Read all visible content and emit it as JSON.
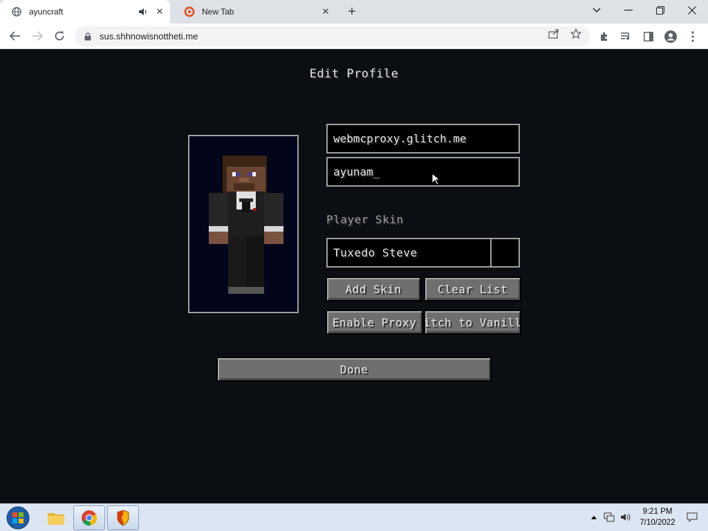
{
  "browser": {
    "tabs": [
      {
        "title": "ayuncraft",
        "icon": "globe-icon",
        "audio": "speaker-icon"
      },
      {
        "title": "New Tab",
        "icon": "duckduckgo-icon"
      }
    ],
    "new_tab_symbol": "+",
    "url": "sus.shhnowisnottheti.me"
  },
  "game": {
    "title": "Edit Profile",
    "server_field": "webmcproxy.glitch.me",
    "username_field": "ayunam_",
    "skin_label": "Player Skin",
    "skin_value": "Tuxedo Steve",
    "buttons": {
      "add_skin": "Add Skin",
      "clear_list": "Clear List",
      "enable_proxy": "Enable Proxy",
      "switch_vanilla": "witch to Vanilla",
      "done": "Done"
    }
  },
  "taskbar": {
    "time": "9:21 PM",
    "date": "7/10/2022",
    "apps": [
      "file-explorer-icon",
      "chrome-icon",
      "security-shield-icon"
    ]
  }
}
